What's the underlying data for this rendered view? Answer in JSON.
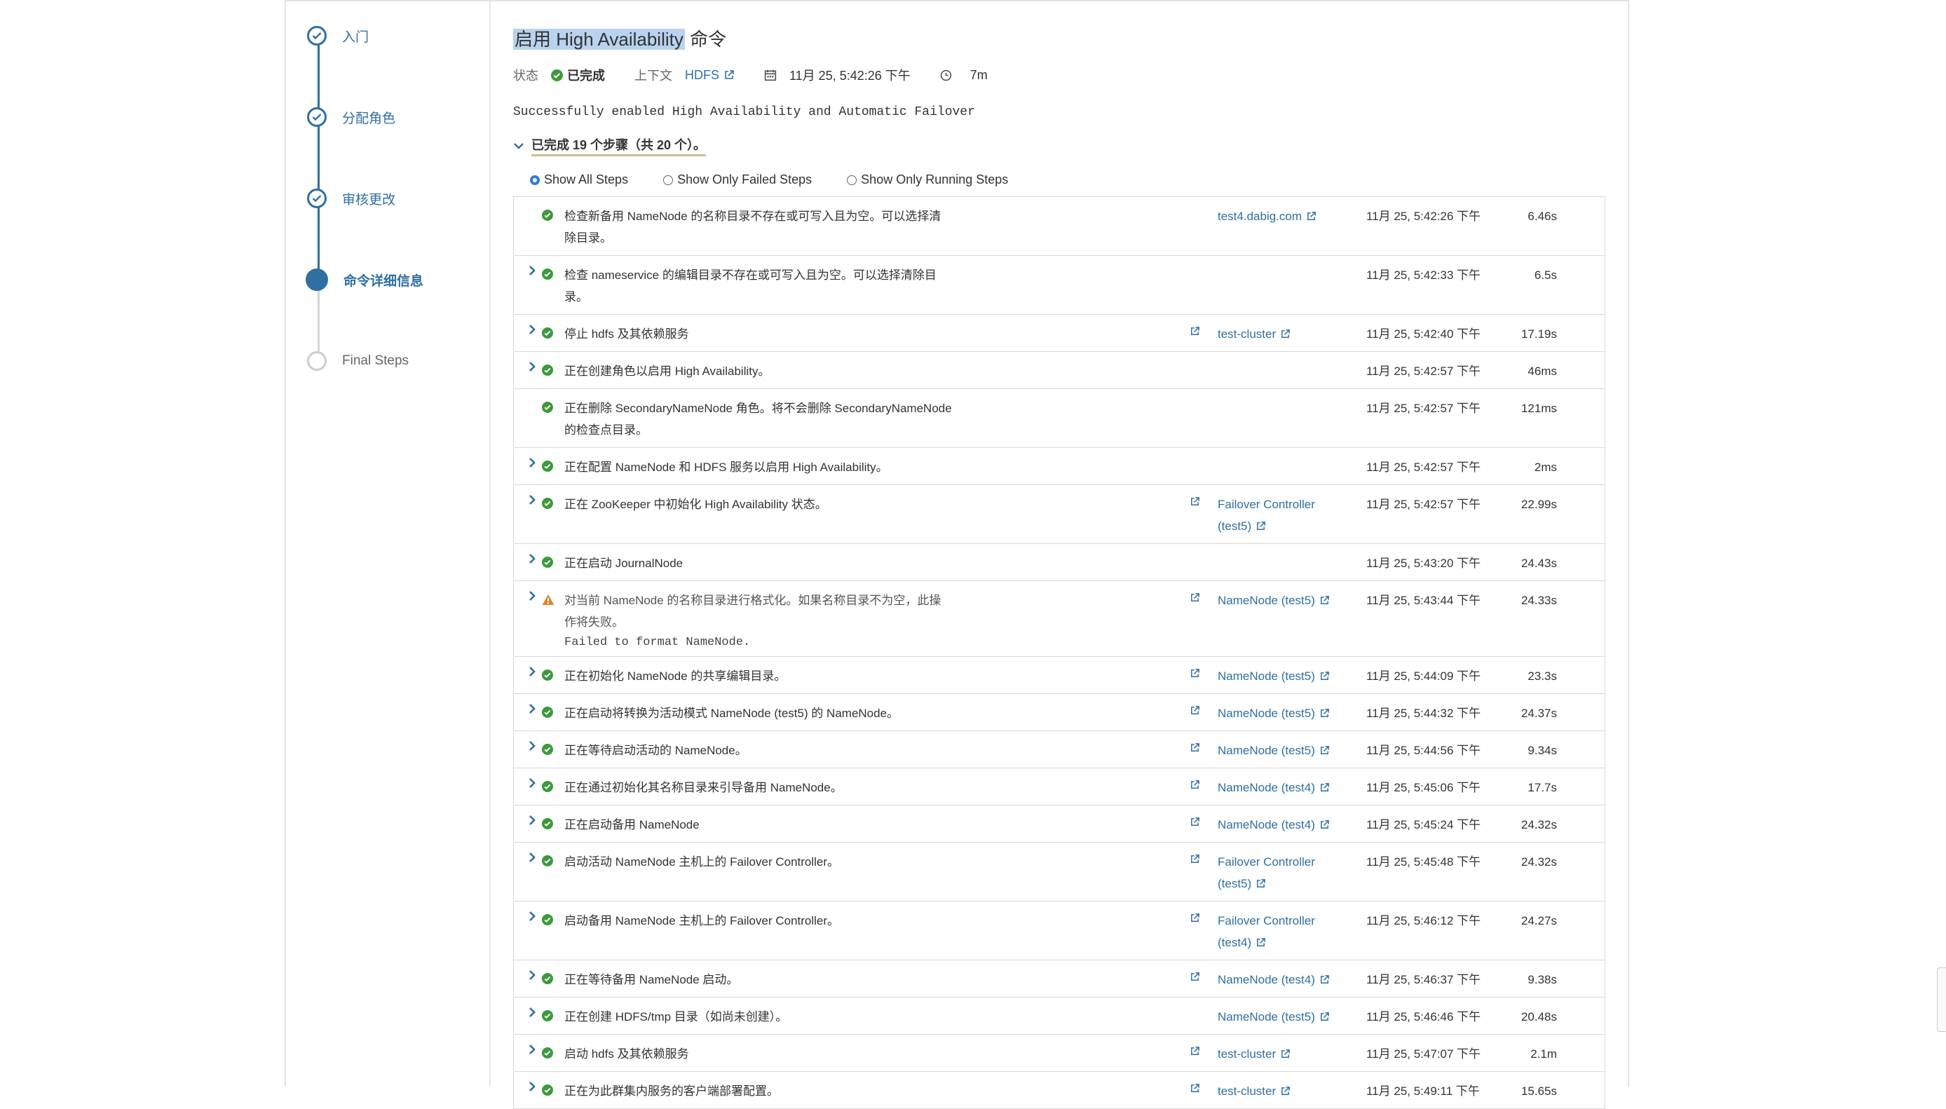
{
  "wizard": {
    "steps": [
      {
        "label": "入门",
        "state": "done"
      },
      {
        "label": "分配角色",
        "state": "done"
      },
      {
        "label": "审核更改",
        "state": "done"
      },
      {
        "label": "命令详细信息",
        "state": "current"
      },
      {
        "label": "Final Steps",
        "state": "todo"
      }
    ]
  },
  "header": {
    "title_hl": "启用 High Availability",
    "title_rest": " 命令",
    "status_label": "状态",
    "status_value": "已完成",
    "context_label": "上下文",
    "context_link": "HDFS",
    "date": "11月 25, 5:42:26 下午",
    "duration": "7m"
  },
  "message": "Successfully enabled High Availability and Automatic Failover",
  "summary": "已完成 19 个步骤（共 20 个）。",
  "filters": {
    "all": "Show All Steps",
    "failed": "Show Only Failed Steps",
    "running": "Show Only Running Steps"
  },
  "colors": {
    "accent": "#2f6fa3",
    "success": "#3c9a3c",
    "warning": "#e0872b"
  },
  "steps": [
    {
      "expand": false,
      "status": "ok",
      "desc": [
        "检查新备用 NameNode 的名称目录不存在或可写入且为空。可以选择清",
        "除目录。"
      ],
      "link_icon": false,
      "role": "test4.dabig.com",
      "time": "11月 25, 5:42:26 下午",
      "dur": "6.46s",
      "h": 84
    },
    {
      "expand": true,
      "status": "ok",
      "desc": [
        "检查 nameservice 的编辑目录不存在或可写入且为空。可以选择清除目",
        "录。"
      ],
      "link_icon": false,
      "role": "",
      "time": "11月 25, 5:42:33 下午",
      "dur": "6.5s",
      "h": 84
    },
    {
      "expand": true,
      "status": "ok",
      "desc": [
        "停止 hdfs 及其依赖服务"
      ],
      "link_icon": true,
      "role": "test-cluster",
      "time": "11月 25, 5:42:40 下午",
      "dur": "17.19s",
      "h": 53
    },
    {
      "expand": true,
      "status": "ok",
      "desc": [
        "正在创建角色以启用 High Availability。"
      ],
      "link_icon": false,
      "role": "",
      "time": "11月 25, 5:42:57 下午",
      "dur": "46ms",
      "h": 53
    },
    {
      "expand": false,
      "status": "ok",
      "desc": [
        "正在删除 SecondaryNameNode 角色。将不会删除 SecondaryNameNode",
        "的检查点目录。"
      ],
      "link_icon": false,
      "role": "",
      "time": "11月 25, 5:42:57 下午",
      "dur": "121ms",
      "h": 84
    },
    {
      "expand": true,
      "status": "ok",
      "desc": [
        "正在配置 NameNode 和 HDFS 服务以启用 High Availability。"
      ],
      "link_icon": false,
      "role": "",
      "time": "11月 25, 5:42:57 下午",
      "dur": "2ms",
      "h": 53
    },
    {
      "expand": true,
      "status": "ok",
      "desc": [
        "正在 ZooKeeper 中初始化 High Availability 状态。"
      ],
      "link_icon": true,
      "role": "Failover Controller (test5)",
      "time": "11月 25, 5:42:57 下午",
      "dur": "22.99s",
      "h": 84
    },
    {
      "expand": true,
      "status": "ok",
      "desc": [
        "正在启动 JournalNode"
      ],
      "link_icon": false,
      "role": "",
      "time": "11月 25, 5:43:20 下午",
      "dur": "24.43s",
      "h": 53
    },
    {
      "expand": true,
      "status": "warn",
      "desc": [
        "对当前 NameNode 的名称目录进行格式化。如果名称目录不为空，此操",
        "作将失败。"
      ],
      "fail": "Failed to format NameNode.",
      "link_icon": true,
      "role": "NameNode (test5)",
      "time": "11月 25, 5:43:44 下午",
      "dur": "24.33s",
      "h": 108
    },
    {
      "expand": true,
      "status": "ok",
      "desc": [
        "正在初始化 NameNode 的共享编辑目录。"
      ],
      "link_icon": true,
      "role": "NameNode (test5)",
      "time": "11月 25, 5:44:09 下午",
      "dur": "23.3s",
      "h": 53
    },
    {
      "expand": true,
      "status": "ok",
      "desc": [
        "正在启动将转换为活动模式 NameNode (test5) 的 NameNode。"
      ],
      "link_icon": true,
      "role": "NameNode (test5)",
      "time": "11月 25, 5:44:32 下午",
      "dur": "24.37s",
      "h": 53
    },
    {
      "expand": true,
      "status": "ok",
      "desc": [
        "正在等待启动活动的 NameNode。"
      ],
      "link_icon": true,
      "role": "NameNode (test5)",
      "time": "11月 25, 5:44:56 下午",
      "dur": "9.34s",
      "h": 53
    },
    {
      "expand": true,
      "status": "ok",
      "desc": [
        "正在通过初始化其名称目录来引导备用 NameNode。"
      ],
      "link_icon": true,
      "role": "NameNode (test4)",
      "time": "11月 25, 5:45:06 下午",
      "dur": "17.7s",
      "h": 53
    },
    {
      "expand": true,
      "status": "ok",
      "desc": [
        "正在启动备用 NameNode"
      ],
      "link_icon": true,
      "role": "NameNode (test4)",
      "time": "11月 25, 5:45:24 下午",
      "dur": "24.32s",
      "h": 53
    },
    {
      "expand": true,
      "status": "ok",
      "desc": [
        "启动活动 NameNode 主机上的 Failover Controller。"
      ],
      "link_icon": true,
      "role": "Failover Controller (test5)",
      "time": "11月 25, 5:45:48 下午",
      "dur": "24.32s",
      "h": 84
    },
    {
      "expand": true,
      "status": "ok",
      "desc": [
        "启动备用 NameNode 主机上的 Failover Controller。"
      ],
      "link_icon": true,
      "role": "Failover Controller (test4)",
      "time": "11月 25, 5:46:12 下午",
      "dur": "24.27s",
      "h": 84
    },
    {
      "expand": true,
      "status": "ok",
      "desc": [
        "正在等待备用 NameNode 启动。"
      ],
      "link_icon": true,
      "role": "NameNode (test4)",
      "time": "11月 25, 5:46:37 下午",
      "dur": "9.38s",
      "h": 53
    },
    {
      "expand": true,
      "status": "ok",
      "desc": [
        "正在创建 HDFS/tmp 目录（如尚未创建）。"
      ],
      "link_icon": false,
      "role": "NameNode (test5)",
      "time": "11月 25, 5:46:46 下午",
      "dur": "20.48s",
      "h": 53
    },
    {
      "expand": true,
      "status": "ok",
      "desc": [
        "启动 hdfs 及其依赖服务"
      ],
      "link_icon": true,
      "role": "test-cluster",
      "time": "11月 25, 5:47:07 下午",
      "dur": "2.1m",
      "h": 53
    },
    {
      "expand": true,
      "status": "ok",
      "desc": [
        "正在为此群集内服务的客户端部署配置。"
      ],
      "link_icon": true,
      "role": "test-cluster",
      "time": "11月 25, 5:49:11 下午",
      "dur": "15.65s",
      "h": 53
    }
  ]
}
